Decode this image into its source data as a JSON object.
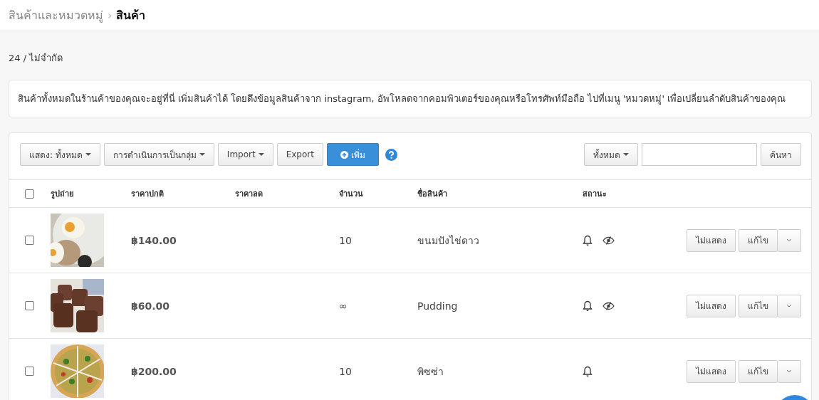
{
  "breadcrumb": {
    "parent": "สินค้าและหมวดหมู่",
    "separator": "›",
    "current": "สินค้า"
  },
  "quota": "24 / ไม่จำกัด",
  "info": "สินค้าทั้งหมดในร้านค้าของคุณจะอยู่ที่นี่ เพิ่มสินค้าได้ โดยดึงข้อมูลสินค้าจาก instagram, อัพโหลดจากคอมพิวเตอร์ของคุณหรือโทรศัพท์มือถือ ไปที่เมนู 'หมวดหมู่' เพื่อเปลี่ยนลำดับสินค้าของคุณ",
  "toolbar": {
    "buttons": [
      {
        "label": "แสดง: ทั้งหมด",
        "kind": "dropdown"
      },
      {
        "label": "การดำเนินการเป็นกลุ่ม",
        "kind": "dropdown"
      },
      {
        "label": "Import",
        "kind": "dropdown"
      },
      {
        "label": "Export",
        "kind": "plain"
      },
      {
        "label": "เพิ่ม",
        "kind": "primary"
      }
    ],
    "filter": "ทั้งหมด",
    "search_button": "ค้นหา"
  },
  "table": {
    "select_all_checked": false,
    "columns": [
      "รูปถ่าย",
      "ราคาปกติ",
      "ราคาลด",
      "จำนวน",
      "ชื่อสินค้า",
      "สถานะ"
    ],
    "rows": [
      {
        "checked": false,
        "price": "฿140.00",
        "quantity": "10",
        "name": "ขนมปังไข่ดาว",
        "hidden": true,
        "hide_button": "ไม่แสดง",
        "edit_button": "แก้ไข"
      },
      {
        "checked": false,
        "price": "฿60.00",
        "quantity": "∞",
        "name": "Pudding",
        "hidden": true,
        "hide_button": "ไม่แสดง",
        "edit_button": "แก้ไข"
      },
      {
        "checked": false,
        "price": "฿200.00",
        "quantity": "10",
        "name": "พิซซ่า",
        "hidden": false,
        "hide_button": "ไม่แสดง",
        "edit_button": "แก้ไข"
      }
    ]
  }
}
